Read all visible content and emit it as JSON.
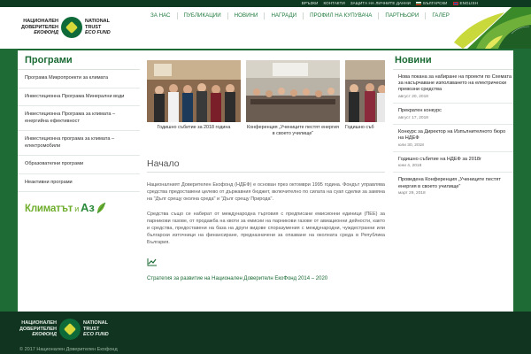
{
  "topbar": {
    "links": [
      "ВРЪЗКИ",
      "КОНТАКТИ",
      "ЗАЩИТА НА ЛИЧНИТЕ ДАННИ"
    ],
    "lang_bg": "БЪЛГАРСКИ",
    "lang_en": "ENGLISH"
  },
  "logo": {
    "bg_line1": "НАЦИОНАЛЕН",
    "bg_line2": "ДОВЕРИТЕЛЕН",
    "bg_line3": "ЕКОФОНД",
    "en_line1": "NATIONAL",
    "en_line2": "TRUST",
    "en_line3": "ECO FUND"
  },
  "nav": [
    "ЗА НАС",
    "ПУБЛИКАЦИИ",
    "НОВИНИ",
    "НАГРАДИ",
    "ПРОФИЛ НА КУПУВАЧА",
    "ПАРТНЬОРИ",
    "ГАЛЕРИЯ"
  ],
  "sidebar": {
    "title": "Програми",
    "items": [
      "Програма Микропроекти за климата",
      "Инвестиционна Програма Минерални води",
      "Инвестиционна Програма за климата – енергийна ефективност",
      "Инвестиционна програма за климата – електромобили",
      "Образователни програми",
      "Неактивни програми"
    ],
    "klimat_logo_main": "Климатът",
    "klimat_logo_and": "и",
    "klimat_logo_az": "Аз"
  },
  "carousel": {
    "prev": "‹",
    "next": "›",
    "captions": [
      "Годишно събитие за 2018 година",
      "Конференция „Учениците пестят енергия в своето училище“",
      "Годишно съб"
    ]
  },
  "main": {
    "title": "Начало",
    "para1": "Националният Доверителен Екофонд (НДЕФ) е основан през октомври 1995 година. Фондът управлява средства предоставени целево от държавния бюджет, включително по силата на суап сделки за замяна на \"Дълг срещу околна среда\" и \"Дълг срещу Природа\".",
    "para2": "Средства също се набират от международна търговия с предписани емисионни единици (ПЕЕ) за парникови газове, от продажба на квоти за емисии на парникови газове от авиационни дейности, както и средства, предоставени на база на други видове споразумения с международни, чуждестранни или български източници на финансиране, предназначени за опазване на околната среда в Република България.",
    "strategy_link": "Стратегия за развитие на Национален Доверителн ЕкоФонд 2014 – 2020"
  },
  "news": {
    "title": "Новини",
    "items": [
      {
        "headline": "Нова покана за набиране на проекти по Схемата за насърчаване използването на електрически превозни средства",
        "date": "август 20, 2018"
      },
      {
        "headline": "Прекратен конкурс",
        "date": "август 17, 2018"
      },
      {
        "headline": "Конкурс за Директор на Изпълнителното бюро на НДЕФ",
        "date": "юли 30, 2018"
      },
      {
        "headline": "Годишно събитие на НДЕФ за 2018г",
        "date": "юни 4, 2018"
      },
      {
        "headline": "Проведена Конференция „Учениците пестят енергия в своето училище“",
        "date": "март 29, 2018"
      }
    ]
  },
  "footer": {
    "copyright": "© 2017 Национален Доверителен Екофонд"
  },
  "colors": {
    "brand_green": "#1e6b35",
    "dark_green": "#10341f",
    "accent_yellow": "#d6d93a",
    "link_green": "#1a6a33"
  },
  "icons": [
    "chart-line-icon",
    "carousel-prev-icon",
    "carousel-next-icon",
    "flag-bg-icon",
    "flag-en-icon"
  ]
}
